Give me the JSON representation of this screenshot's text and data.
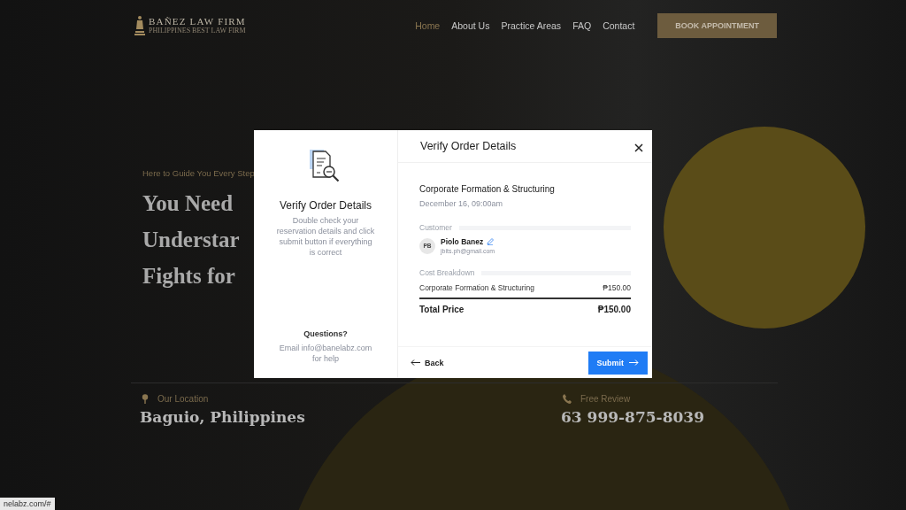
{
  "header": {
    "logo": {
      "name": "BAÑEZ LAW FIRM",
      "tagline": "PHILIPPINES BEST LAW FIRM"
    },
    "nav": [
      {
        "label": "Home",
        "selected": true
      },
      {
        "label": "About Us",
        "selected": false
      },
      {
        "label": "Practice Areas",
        "selected": false
      },
      {
        "label": "FAQ",
        "selected": false
      },
      {
        "label": "Contact",
        "selected": false
      }
    ],
    "cta": "BOOK APPOINTMENT"
  },
  "hero": {
    "eyebrow": "Here to Guide You Every Step",
    "headline_lines": [
      "You Need",
      "Understar",
      "Fights for"
    ]
  },
  "info": [
    {
      "kind": "location",
      "label": "Our Location",
      "value": "Baguio, Philippines"
    },
    {
      "kind": "phone",
      "label": "Free Review",
      "value": "63 999-875-8039"
    }
  ],
  "dialog": {
    "side": {
      "title": "Verify Order Details",
      "description": "Double check your reservation details and click submit button if everything is correct",
      "questions_title": "Questions?",
      "questions_text": "Email info@banelabz.com for help"
    },
    "title": "Verify Order Details",
    "service": "Corporate Formation & Structuring",
    "datetime": "December 16, 09:00am",
    "customer_label": "Customer",
    "customer": {
      "initials": "PB",
      "name": "Piolo Banez",
      "email": "jbits.ph@gmail.com"
    },
    "cost_label": "Cost Breakdown",
    "lines": [
      {
        "label": "Corporate Formation & Structuring",
        "amount": "₱150.00"
      }
    ],
    "total_label": "Total Price",
    "total": "₱150.00",
    "back": "Back",
    "submit": "Submit"
  },
  "status_bar": "nelabz.com/#"
}
